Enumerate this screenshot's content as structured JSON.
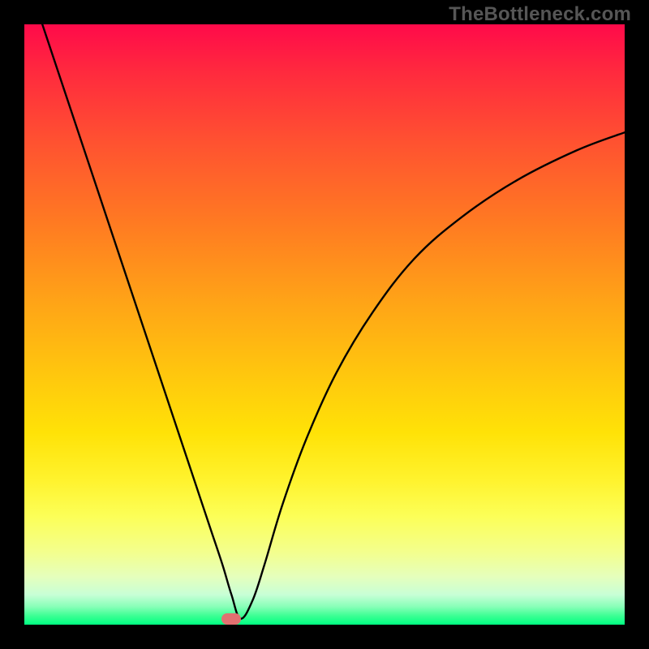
{
  "watermark": "TheBottleneck.com",
  "chart_data": {
    "type": "line",
    "title": "",
    "xlabel": "",
    "ylabel": "",
    "xlim": [
      0,
      100
    ],
    "ylim": [
      0,
      100
    ],
    "grid": false,
    "legend": false,
    "background": "rainbow-gradient-vertical",
    "border": {
      "color": "#000000",
      "width": 30
    },
    "series": [
      {
        "name": "bottleneck-curve",
        "color": "#000000",
        "stroke_width": 2,
        "x": [
          3,
          6,
          10,
          14,
          18,
          22,
          26,
          29,
          31,
          33,
          34.5,
          36,
          38,
          40,
          43,
          47,
          52,
          58,
          65,
          73,
          82,
          92,
          100
        ],
        "y": [
          100,
          91,
          79,
          67,
          55,
          43,
          31,
          22,
          16,
          10,
          5,
          1,
          4,
          10,
          20,
          31,
          42,
          52,
          61,
          68,
          74,
          79,
          82
        ]
      }
    ],
    "annotations": [
      {
        "type": "marker",
        "shape": "pill",
        "color": "#e17070",
        "x": 34.5,
        "y": 1,
        "label": "minimum-marker"
      }
    ]
  }
}
